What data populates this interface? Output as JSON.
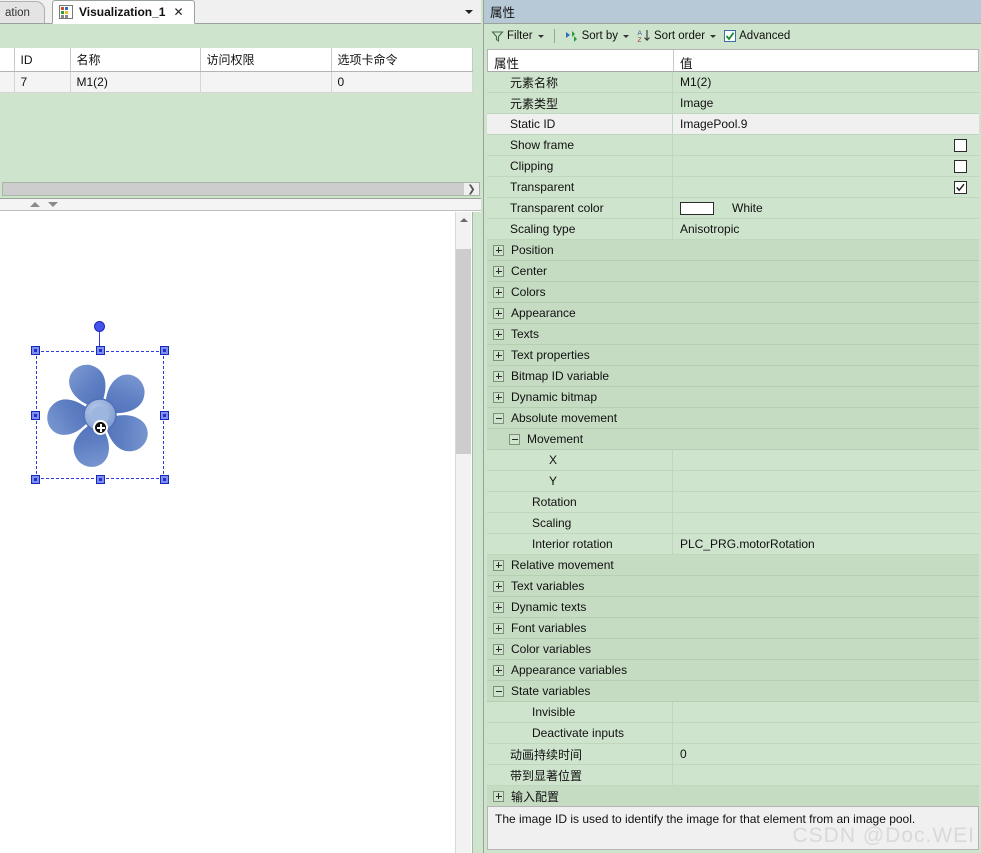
{
  "tabs": {
    "previous_tab_label": "ation",
    "active_tab_label": "Visualization_1",
    "close_glyph": "✕",
    "icon_name": "visualization-icon",
    "dropdown_name": "tab-list-dropdown"
  },
  "elements_table": {
    "columns": [
      "ID",
      "名称",
      "访问权限",
      "选项卡命令"
    ],
    "rows": [
      {
        "id": "7",
        "name": "M1(2)",
        "access": "",
        "command": "0"
      }
    ],
    "hscroll_right_arrow": "❯"
  },
  "canvas": {
    "element_name": "fan-impeller-image",
    "selection_name": "selection-box",
    "rotation_handle": "rotation-handle",
    "center_marker": "center-point-marker"
  },
  "properties": {
    "title": "属性",
    "toolbar": {
      "filter_label": "Filter",
      "sort_by_label": "Sort by",
      "sort_order_label": "Sort order",
      "advanced_label": "Advanced",
      "advanced_checked": true
    },
    "header": {
      "property_col": "属性",
      "value_col": "值"
    },
    "rows": [
      {
        "label": "元素名称",
        "value": "M1(2)",
        "indent": 1,
        "kind": "item"
      },
      {
        "label": "元素类型",
        "value": "Image",
        "indent": 1,
        "kind": "item"
      },
      {
        "label": "Static ID",
        "value": "ImagePool.9",
        "indent": 1,
        "kind": "item",
        "highlight": true
      },
      {
        "label": "Show frame",
        "value": "",
        "indent": 1,
        "kind": "checkbox",
        "checked": false
      },
      {
        "label": "Clipping",
        "value": "",
        "indent": 1,
        "kind": "checkbox",
        "checked": false
      },
      {
        "label": "Transparent",
        "value": "",
        "indent": 1,
        "kind": "checkbox",
        "checked": true
      },
      {
        "label": "Transparent color",
        "value": "White",
        "indent": 1,
        "kind": "color",
        "swatch": "#ffffff"
      },
      {
        "label": "Scaling type",
        "value": "Anisotropic",
        "indent": 1,
        "kind": "item"
      },
      {
        "label": "Position",
        "value": "",
        "indent": 0,
        "kind": "category",
        "expanded": false
      },
      {
        "label": "Center",
        "value": "",
        "indent": 0,
        "kind": "category",
        "expanded": false
      },
      {
        "label": "Colors",
        "value": "",
        "indent": 0,
        "kind": "category",
        "expanded": false
      },
      {
        "label": "Appearance",
        "value": "",
        "indent": 0,
        "kind": "category",
        "expanded": false
      },
      {
        "label": "Texts",
        "value": "",
        "indent": 0,
        "kind": "category",
        "expanded": false
      },
      {
        "label": "Text properties",
        "value": "",
        "indent": 0,
        "kind": "category",
        "expanded": false
      },
      {
        "label": "Bitmap ID variable",
        "value": "",
        "indent": 0,
        "kind": "category",
        "expanded": false
      },
      {
        "label": "Dynamic bitmap",
        "value": "",
        "indent": 0,
        "kind": "category",
        "expanded": false
      },
      {
        "label": "Absolute movement",
        "value": "",
        "indent": 0,
        "kind": "category",
        "expanded": true
      },
      {
        "label": "Movement",
        "value": "",
        "indent": 1,
        "kind": "category",
        "expanded": true
      },
      {
        "label": "X",
        "value": "",
        "indent": 3,
        "kind": "item"
      },
      {
        "label": "Y",
        "value": "",
        "indent": 3,
        "kind": "item"
      },
      {
        "label": "Rotation",
        "value": "",
        "indent": 2,
        "kind": "item"
      },
      {
        "label": "Scaling",
        "value": "",
        "indent": 2,
        "kind": "item"
      },
      {
        "label": "Interior rotation",
        "value": "PLC_PRG.motorRotation",
        "indent": 2,
        "kind": "item"
      },
      {
        "label": "Relative movement",
        "value": "",
        "indent": 0,
        "kind": "category",
        "expanded": false
      },
      {
        "label": "Text variables",
        "value": "",
        "indent": 0,
        "kind": "category",
        "expanded": false
      },
      {
        "label": "Dynamic texts",
        "value": "",
        "indent": 0,
        "kind": "category",
        "expanded": false
      },
      {
        "label": "Font variables",
        "value": "",
        "indent": 0,
        "kind": "category",
        "expanded": false
      },
      {
        "label": "Color variables",
        "value": "",
        "indent": 0,
        "kind": "category",
        "expanded": false
      },
      {
        "label": "Appearance variables",
        "value": "",
        "indent": 0,
        "kind": "category",
        "expanded": false
      },
      {
        "label": "State variables",
        "value": "",
        "indent": 0,
        "kind": "category",
        "expanded": true
      },
      {
        "label": "Invisible",
        "value": "",
        "indent": 2,
        "kind": "item"
      },
      {
        "label": "Deactivate inputs",
        "value": "",
        "indent": 2,
        "kind": "item"
      },
      {
        "label": "动画持续时间",
        "value": "0",
        "indent": 1,
        "kind": "item"
      },
      {
        "label": "带到显著位置",
        "value": "",
        "indent": 1,
        "kind": "item"
      },
      {
        "label": "输入配置",
        "value": "",
        "indent": 0,
        "kind": "category",
        "expanded": false
      }
    ],
    "description": "The image ID is used to identify the image for that element from an image pool."
  },
  "watermark": "CSDN @Doc.WEI",
  "colors": {
    "panel_green": "#cfe4cd",
    "category_green": "#c5dcc3",
    "title_blue": "#b7c8d6",
    "selection_blue": "#2c3ae0",
    "fan_blue": "#5f7fc4"
  }
}
